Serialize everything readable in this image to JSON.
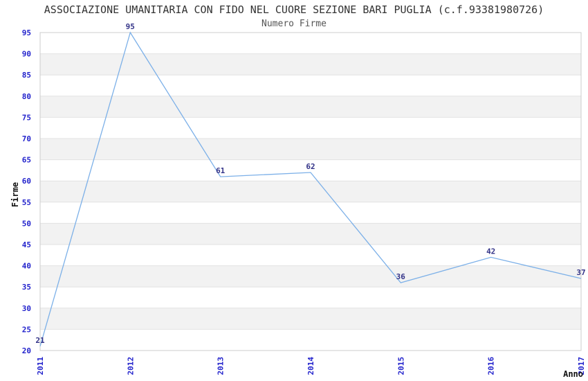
{
  "chart_data": {
    "type": "line",
    "title": "ASSOCIAZIONE UMANITARIA CON FIDO NEL CUORE SEZIONE BARI PUGLIA (c.f.93381980726)",
    "subtitle": "Numero Firme",
    "xlabel": "Anno",
    "ylabel": "Firme",
    "categories": [
      "2011",
      "2012",
      "2013",
      "2014",
      "2015",
      "2016",
      "2017"
    ],
    "values": [
      21,
      95,
      61,
      62,
      36,
      42,
      37
    ],
    "point_labels": [
      "21",
      "95",
      "61",
      "62",
      "36",
      "42",
      "37"
    ],
    "ylim": [
      20,
      95
    ],
    "ytick_step": 5,
    "yticks": [
      20,
      25,
      30,
      35,
      40,
      45,
      50,
      55,
      60,
      65,
      70,
      75,
      80,
      85,
      90,
      95
    ],
    "grid": "horizontal-alternating-bands",
    "legend": "none",
    "colors": {
      "line": "#7CB0E8",
      "tick_label": "#2222CC",
      "value_label": "#333388",
      "band_gray": "#F2F2F2",
      "band_white": "#FFFFFF",
      "grid_line": "#E2E2E2",
      "border": "#CCCCCC",
      "title": "#333333",
      "subtitle": "#555555",
      "axis_title": "#111111",
      "background": "#FFFFFF"
    }
  }
}
